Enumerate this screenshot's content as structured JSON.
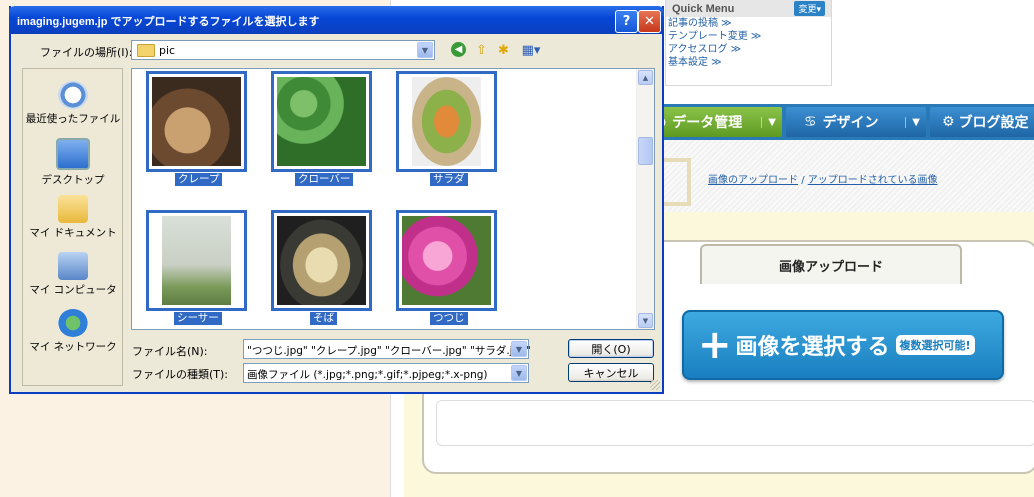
{
  "background_page": {
    "quick_menu": {
      "title": "Quick Menu",
      "change_button": "変更▾",
      "links": [
        "記事の投稿 ≫",
        "テンプレート変更 ≫",
        "アクセスログ ≫",
        "基本設定 ≫"
      ]
    },
    "nav": {
      "data_mgmt": "データ管理",
      "design": "デザイン",
      "blog_settings": "ブログ設定"
    },
    "breadcrumb": {
      "upload": "画像のアップロード",
      "separator": "/",
      "uploaded": "アップロードされている画像"
    },
    "upload_tab": "画像アップロード",
    "select_button": {
      "plus": "+",
      "label": "画像を選択する",
      "badge": "複数選択可能!"
    }
  },
  "dialog": {
    "title": "imaging.jugem.jp でアップロードするファイルを選択します",
    "help_button": "?",
    "close_button": "✕",
    "look_in_label": "ファイルの場所(I):",
    "look_in_value": "pic",
    "places": [
      {
        "label": "最近使ったファイル",
        "icon": "recent-documents-icon"
      },
      {
        "label": "デスクトップ",
        "icon": "desktop-icon"
      },
      {
        "label": "マイ ドキュメント",
        "icon": "my-documents-icon"
      },
      {
        "label": "マイ コンピュータ",
        "icon": "my-computer-icon"
      },
      {
        "label": "マイ ネットワーク",
        "icon": "my-network-icon"
      }
    ],
    "files": [
      {
        "name": "クレープ",
        "selected": true
      },
      {
        "name": "クローバー",
        "selected": true
      },
      {
        "name": "サラダ",
        "selected": true
      },
      {
        "name": "シーサー",
        "selected": true
      },
      {
        "name": "そば",
        "selected": true
      },
      {
        "name": "つつじ",
        "selected": true
      }
    ],
    "file_name_label": "ファイル名(N):",
    "file_name_value": "\"つつじ.jpg\" \"クレープ.jpg\" \"クローバー.jpg\" \"サラダ.jpg\"",
    "file_type_label": "ファイルの種類(T):",
    "file_type_value": "画像ファイル (*.jpg;*.png;*.gif;*.pjpeg;*.x-png)",
    "open_button": "開く(O)",
    "cancel_button": "キャンセル"
  },
  "colors": {
    "titlebar": "#0a4bd6",
    "selection": "#316ac5",
    "nav_blue": "#2a7ab8",
    "nav_green": "#6aa52c"
  }
}
